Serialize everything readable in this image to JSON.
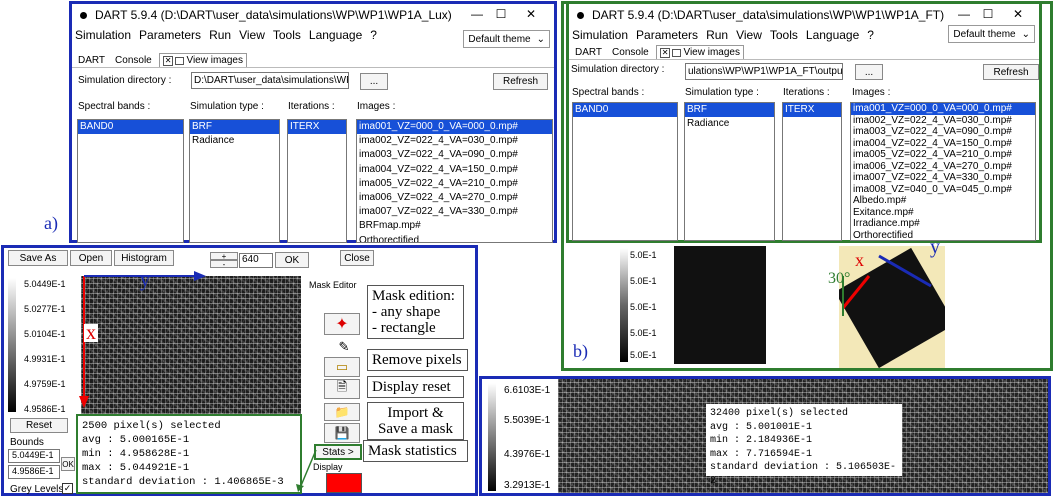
{
  "win_a": {
    "title": "DART 5.9.4 (D:\\DART\\user_data\\simulations\\WP\\WP1\\WP1A_Lux)",
    "menu": [
      "Simulation",
      "Parameters",
      "Run",
      "View",
      "Tools",
      "Language",
      "?"
    ],
    "theme": "Default theme",
    "tabs": [
      "DART",
      "Console",
      "View images"
    ],
    "simdir_label": "Simulation directory :",
    "simdir_value": "D:\\DART\\user_data\\simulations\\WP",
    "browse": "...",
    "refresh": "Refresh",
    "bands_label": "Spectral bands :",
    "simtype_label": "Simulation type :",
    "iter_label": "Iterations :",
    "images_label": "Images :",
    "bands": [
      "BAND0"
    ],
    "simtypes": [
      "BRF",
      "Radiance"
    ],
    "iterations": [
      "ITERX"
    ],
    "images": [
      "ima001_VZ=000_0_VA=000_0.mp#",
      "ima002_VZ=022_4_VA=030_0.mp#",
      "ima003_VZ=022_4_VA=090_0.mp#",
      "ima004_VZ=022_4_VA=150_0.mp#",
      "ima005_VZ=022_4_VA=210_0.mp#",
      "ima006_VZ=022_4_VA=270_0.mp#",
      "ima007_VZ=022_4_VA=330_0.mp#",
      "BRFmap.mp#",
      "Orthorectified"
    ]
  },
  "win_b": {
    "title": "DART 5.9.4 (D:\\DART\\user_data\\simulations\\WP\\WP1\\WP1A_FT)",
    "menu": [
      "Simulation",
      "Parameters",
      "Run",
      "View",
      "Tools",
      "Language",
      "?"
    ],
    "theme": "Default theme",
    "tabs": [
      "DART",
      "Console",
      "View images"
    ],
    "simdir_label": "Simulation directory :",
    "simdir_value": "ulations\\WP\\WP1\\WP1A_FT\\output",
    "browse": "...",
    "refresh": "Refresh",
    "bands_label": "Spectral bands :",
    "simtype_label": "Simulation type :",
    "iter_label": "Iterations :",
    "images_label": "Images :",
    "bands": [
      "BAND0"
    ],
    "simtypes": [
      "BRF",
      "Radiance"
    ],
    "iterations": [
      "ITERX"
    ],
    "images": [
      "ima001_VZ=000_0_VA=000_0.mp#",
      "ima002_VZ=022_4_VA=030_0.mp#",
      "ima003_VZ=022_4_VA=090_0.mp#",
      "ima004_VZ=022_4_VA=150_0.mp#",
      "ima005_VZ=022_4_VA=210_0.mp#",
      "ima006_VZ=022_4_VA=270_0.mp#",
      "ima007_VZ=022_4_VA=330_0.mp#",
      "ima008_VZ=040_0_VA=045_0.mp#",
      "Albedo.mp#",
      "Exitance.mp#",
      "Irradiance.mp#",
      "Orthorectified"
    ]
  },
  "labels": {
    "a": "a)",
    "b": "b)"
  },
  "viewer": {
    "save_as": "Save As",
    "open": "Open",
    "histogram": "Histogram",
    "plus": "+",
    "minus": "-",
    "zoom": "640",
    "ok": "OK",
    "close": "Close",
    "mask_editor": "Mask Editor",
    "scale": [
      "5.0449E-1",
      "5.0277E-1",
      "5.0104E-1",
      "4.9931E-1",
      "4.9759E-1",
      "4.9586E-1"
    ],
    "reset": "Reset",
    "bounds": "Bounds",
    "bound_max": "5.0449E-1",
    "bound_min": "4.9586E-1",
    "bounds_ok": "OK",
    "grey_levels": "Grey Levels",
    "stats_btn": "Stats >",
    "display": "Display",
    "axis_x": "x",
    "axis_y": "y",
    "stats": [
      "2500 pixel(s) selected",
      "avg : 5.000165E-1",
      "min : 4.958628E-1",
      "max : 5.044921E-1",
      "standard deviation : 1.406865E-3"
    ]
  },
  "callouts": {
    "mask_edition": [
      "Mask edition:",
      "- any shape",
      "- rectangle"
    ],
    "remove_pixels": "Remove pixels",
    "display_reset": "Display reset",
    "import_save": [
      "Import &",
      "Save a mask"
    ],
    "mask_stats": "Mask statistics"
  },
  "viewer_b": {
    "scale": [
      "5.0E-1",
      "5.0E-1",
      "5.0E-1",
      "5.0E-1",
      "5.0E-1"
    ],
    "axis_x": "x",
    "axis_y": "y",
    "angle": "30°"
  },
  "viewer_c": {
    "scale": [
      "6.6103E-1",
      "5.5039E-1",
      "4.3976E-1",
      "3.2913E-1"
    ],
    "stats": [
      "32400 pixel(s) selected",
      "avg : 5.001001E-1",
      "min : 2.184936E-1",
      "max : 7.716594E-1",
      "standard deviation : 5.106503E-2"
    ]
  },
  "colors": {
    "frame_blue": "#1a2bb5",
    "frame_green": "#2f7d2f",
    "selection": "#1750d8",
    "display_swatch": "#ff0000"
  }
}
